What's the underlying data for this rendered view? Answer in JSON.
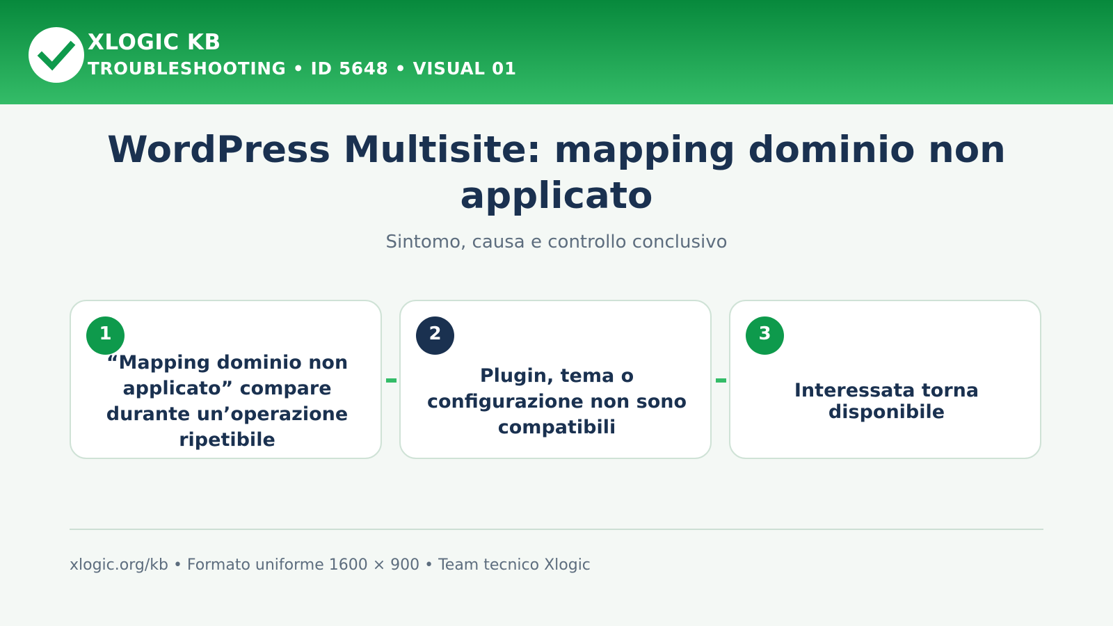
{
  "header": {
    "brand": "XLOGIC KB",
    "breadcrumb": "TROUBLESHOOTING • ID 5648 • VISUAL 01"
  },
  "main": {
    "title": "WordPress Multisite: mapping dominio non applicato",
    "subtitle": "Sintomo, causa e controllo conclusivo"
  },
  "steps": [
    {
      "number": "1",
      "text": "“Mapping dominio non applicato” compare durante un’operazione ripetibile"
    },
    {
      "number": "2",
      "text": "Plugin, tema o configurazione non sono compatibili"
    },
    {
      "number": "3",
      "text": "Interessata torna disponibile"
    }
  ],
  "footer": {
    "text": "xlogic.org/kb • Formato uniforme 1600 × 900 • Team tecnico Xlogic"
  },
  "colors": {
    "brand_green": "#0e9a4c",
    "header_gradient_top": "#07893c",
    "header_gradient_bottom": "#34bc68",
    "navy": "#1a3150",
    "muted_text": "#5d6d7e",
    "background": "#f4f8f5"
  },
  "icons": {
    "logo": "checkmark-icon"
  }
}
